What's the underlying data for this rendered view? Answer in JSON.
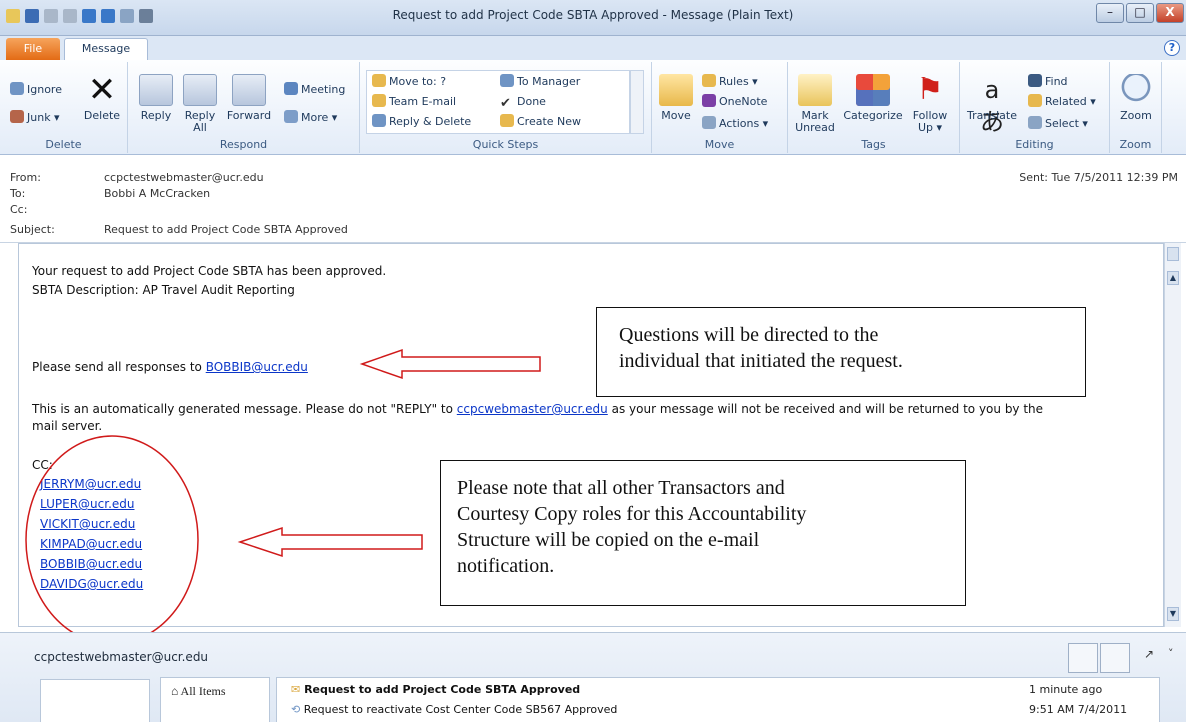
{
  "window": {
    "title": "Request to add Project Code SBTA Approved - Message (Plain Text)",
    "min": "–",
    "max": "□",
    "close": "X"
  },
  "tabs": {
    "file": "File",
    "message": "Message",
    "help_icon": "?"
  },
  "ribbon": {
    "delete_group": {
      "label": "Delete",
      "ignore": "Ignore",
      "junk": "Junk ▾",
      "delete": "Delete"
    },
    "respond_group": {
      "label": "Respond",
      "reply": "Reply",
      "reply_all": "Reply All",
      "forward": "Forward",
      "meeting": "Meeting",
      "more": "More ▾"
    },
    "quick_steps": {
      "label": "Quick Steps",
      "items": [
        "Move to: ?",
        "Team E-mail",
        "Reply & Delete",
        "To Manager",
        "Done",
        "Create New"
      ]
    },
    "move_group": {
      "label": "Move",
      "move": "Move",
      "rules": "Rules ▾",
      "onenote": "OneNote",
      "actions": "Actions ▾"
    },
    "tags_group": {
      "label": "Tags",
      "mark_unread": "Mark Unread",
      "categorize": "Categorize",
      "follow_up": "Follow Up ▾"
    },
    "editing_group": {
      "label": "Editing",
      "translate": "Translate",
      "find": "Find",
      "related": "Related ▾",
      "select": "Select ▾"
    },
    "zoom_group": {
      "label": "Zoom",
      "zoom": "Zoom"
    }
  },
  "header": {
    "from_label": "From:",
    "from": "ccpctestwebmaster@ucr.edu",
    "to_label": "To:",
    "to": "Bobbi A McCracken",
    "cc_label": "Cc:",
    "subject_label": "Subject:",
    "subject": "Request to add Project Code SBTA Approved",
    "sent_label": "Sent:",
    "sent": "Tue 7/5/2011 12:39 PM"
  },
  "body": {
    "line1": "Your request to add Project Code SBTA has been approved.",
    "line2": "SBTA Description: AP Travel Audit Reporting",
    "send_prefix": "Please send all responses to ",
    "send_email": "BOBBIB@ucr.edu",
    "auto_prefix": "This is an automatically generated message. Please do not \"REPLY\" to ",
    "auto_email": "ccpcwebmaster@ucr.edu",
    "auto_suffix": " as your message will not be received and will be returned to you by the",
    "auto_line2": "mail server.",
    "cc_label": "CC:",
    "cc_list": [
      "JERRYM@ucr.edu",
      "LUPER@ucr.edu",
      "VICKIT@ucr.edu",
      "KIMPAD@ucr.edu",
      "BOBBIB@ucr.edu",
      "DAVIDG@ucr.edu"
    ]
  },
  "annotations": {
    "callout1_line1": "Questions will be directed to the",
    "callout1_line2": "individual that initiated the request.",
    "callout2_line1": "Please note that all other Transactors and",
    "callout2_line2": "Courtesy Copy roles for this Accountability",
    "callout2_line3": "Structure will be copied on the e-mail",
    "callout2_line4": "notification.",
    "arrow_color": "#d01a1a"
  },
  "people_pane": {
    "name": "ccpctestwebmaster@ucr.edu",
    "all_items": "All Items",
    "items": [
      {
        "subject": "Request to add Project Code SBTA Approved",
        "time": "1 minute ago"
      },
      {
        "subject": "Request to reactivate Cost Center Code SB567 Approved",
        "time": "9:51 AM 7/4/2011"
      }
    ]
  }
}
